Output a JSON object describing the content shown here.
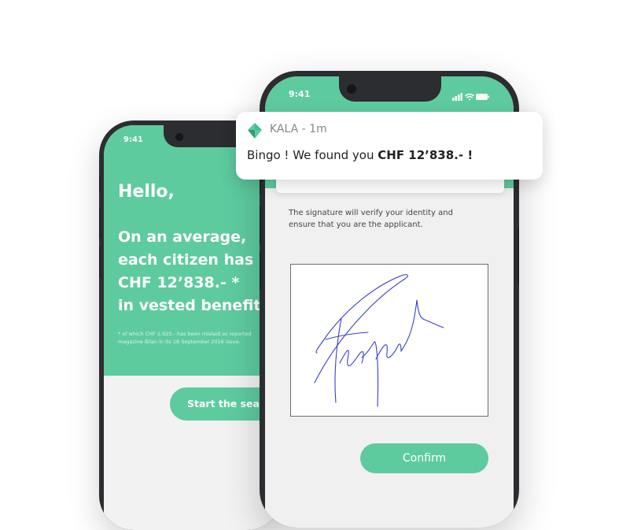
{
  "left_phone": {
    "time": "9:41",
    "hello": "Hello,",
    "average_lines": [
      "On an average,",
      "each citizen has",
      "CHF 12’838.- *",
      "in vested benefit"
    ],
    "footnote_lines": [
      "* of which CHF 1,925.- has been mislaid as reported",
      "magazine Bilan in its 18 September 2016 issue."
    ],
    "start_button_label": "Start the sear"
  },
  "right_phone": {
    "time": "9:41",
    "signature_text_lines": [
      "The signature will verify your identity and",
      "ensure that you are the applicant."
    ],
    "confirm_label": "Confirm"
  },
  "notification": {
    "app_label": "KALA - 1m",
    "message_prefix": "Bingo ! We found you ",
    "message_amount": "CHF 12’838.- !"
  },
  "colors": {
    "accent_green": "#5ecb9f",
    "logo_green": "#3ebf8c",
    "phone_frame": "#2c2d30",
    "signature_ink": "#3a3fd0"
  },
  "icons": [
    "signal-icon",
    "wifi-icon",
    "battery-icon",
    "kala-logo-icon"
  ]
}
